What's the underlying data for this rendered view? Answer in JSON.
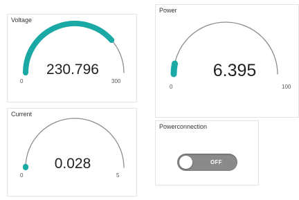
{
  "colors": {
    "accent": "#1aa9a4",
    "track": "#8c8c8c"
  },
  "gauges": {
    "voltage": {
      "title": "Voltage",
      "value": "230.796",
      "min": "0",
      "max": "300",
      "fraction": 0.77
    },
    "power": {
      "title": "Power",
      "value": "6.395",
      "min": "0",
      "max": "100",
      "fraction": 0.064
    },
    "current": {
      "title": "Current",
      "value": "0.028",
      "min": "0",
      "max": "5",
      "fraction": 0.0056
    }
  },
  "switch": {
    "title": "Powerconnection",
    "state_label": "OFF"
  }
}
